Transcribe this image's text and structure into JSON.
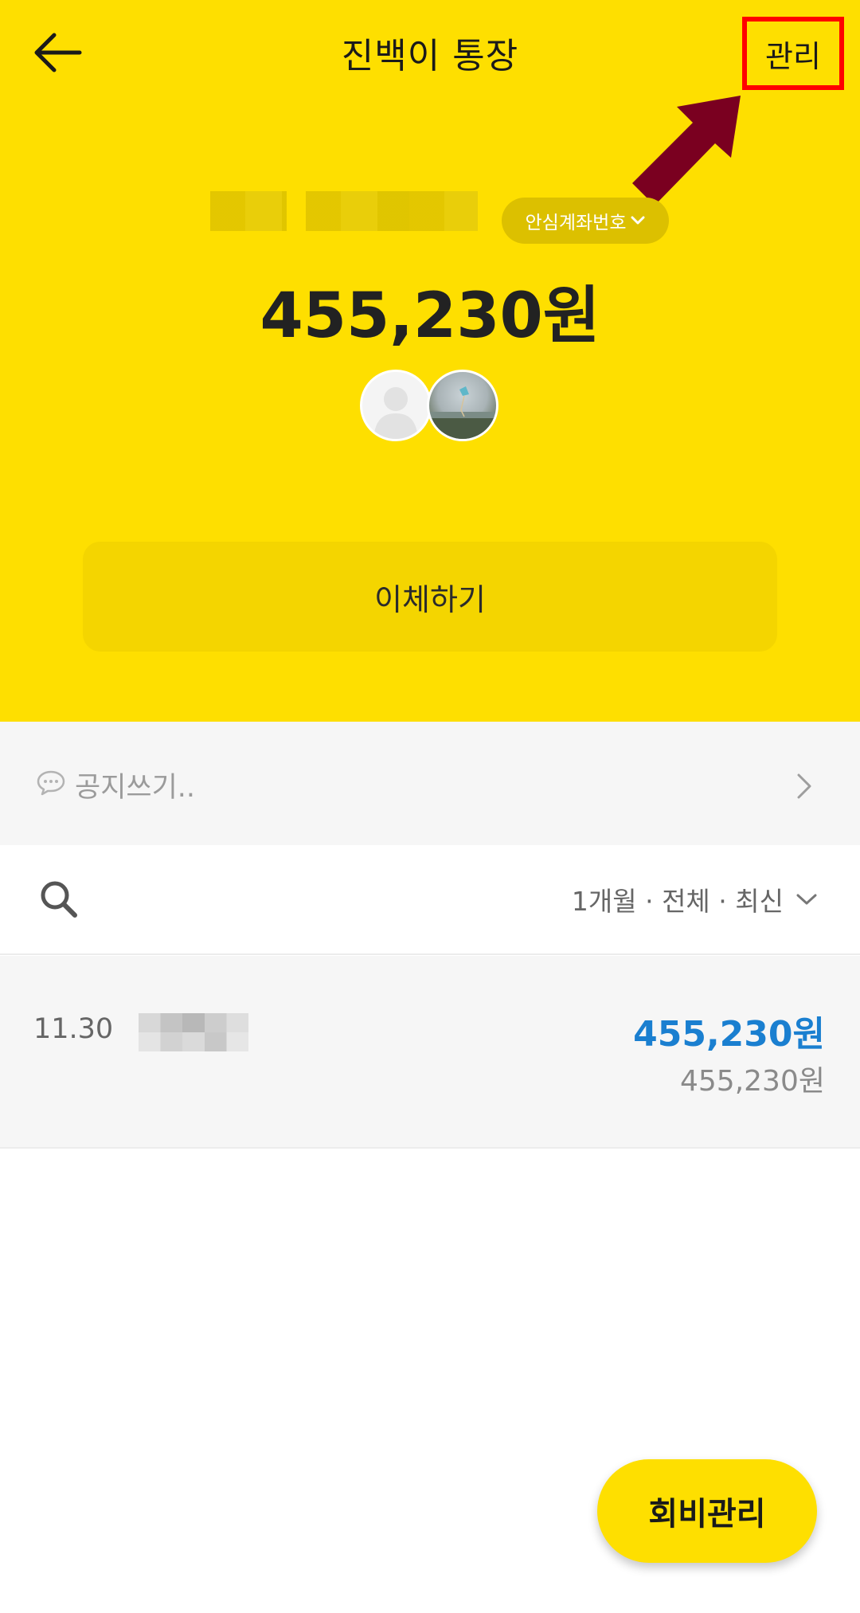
{
  "header": {
    "title": "진백이 통장",
    "back_icon": "arrow-left-icon",
    "manage_label": "관리"
  },
  "account": {
    "safe_number_label": "안심계좌번호",
    "balance": "455,230원",
    "hero_color": "#fedf00"
  },
  "actions": {
    "transfer_label": "이체하기"
  },
  "notice": {
    "placeholder": "공지쓰기..",
    "icon": "chat-bubble-icon"
  },
  "filter": {
    "label": "1개월 · 전체 · 최신"
  },
  "transactions": [
    {
      "date": "11.30",
      "amount": "455,230원",
      "balance_after": "455,230원",
      "amount_color": "#1a7fd0"
    }
  ],
  "fab": {
    "label": "회비관리"
  },
  "annotation": {
    "highlight_color": "#ff0000",
    "arrow_color": "#7a0020"
  }
}
